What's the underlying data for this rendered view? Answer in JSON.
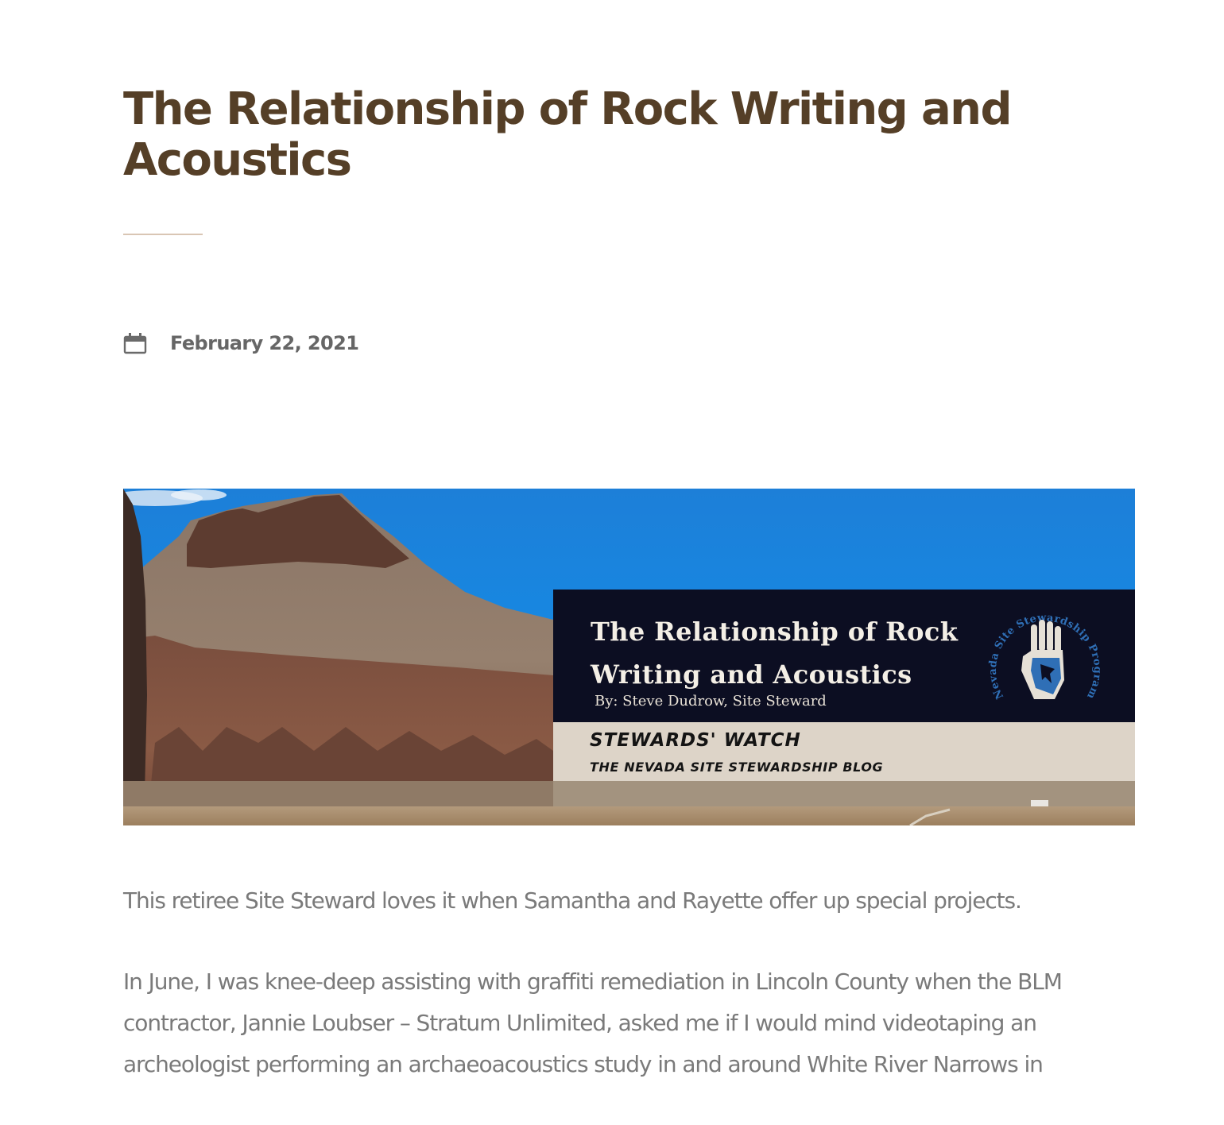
{
  "post": {
    "title": "The Relationship of Rock Writing and Acoustics",
    "date": "February 22, 2021",
    "date_icon": "calendar-icon"
  },
  "banner": {
    "title": "The Relationship of Rock Writing and Acoustics",
    "byline": "By: Steve Dudrow, Site Steward",
    "blog_name": "STEWARDS' WATCH",
    "blog_tagline": "THE NEVADA SITE STEWARDSHIP BLOG",
    "logo_text": "Nevada Site Stewardship Program",
    "colors": {
      "sky": "#1a86de",
      "dark_panel": "#0c0e22",
      "light_panel": "#ddd4c8",
      "logo_blue": "#2f6fb6"
    }
  },
  "body": {
    "paragraphs": [
      "This retiree Site Steward loves it when Samantha and Rayette offer up special projects.",
      "In June, I was knee-deep assisting with graffiti remediation in Lincoln County when the BLM contractor, Jannie Loubser – Stratum Unlimited, asked me if I would mind videotaping an archeologist performing an archaeoacoustics study in and around White River Narrows in"
    ]
  },
  "colors": {
    "title": "#553f27",
    "rule": "#d9c6b4",
    "meta": "#666666",
    "body": "#7a7a7a"
  }
}
